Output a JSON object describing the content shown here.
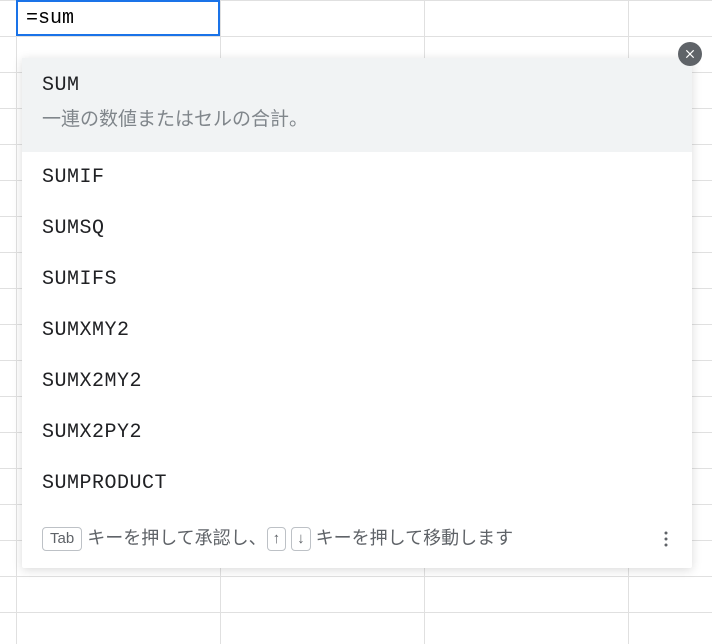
{
  "cell": {
    "value": "=sum"
  },
  "suggestions": {
    "highlighted": {
      "name": "SUM",
      "description": "一連の数値またはセルの合計。"
    },
    "items": [
      {
        "name": "SUMIF"
      },
      {
        "name": "SUMSQ"
      },
      {
        "name": "SUMIFS"
      },
      {
        "name": "SUMXMY2"
      },
      {
        "name": "SUMX2MY2"
      },
      {
        "name": "SUMX2PY2"
      },
      {
        "name": "SUMPRODUCT"
      }
    ]
  },
  "hint": {
    "tab_key": "Tab",
    "text1": " キーを押して承認し、",
    "up_key": "↑",
    "down_key": "↓",
    "text2": " キーを押して移動します"
  }
}
